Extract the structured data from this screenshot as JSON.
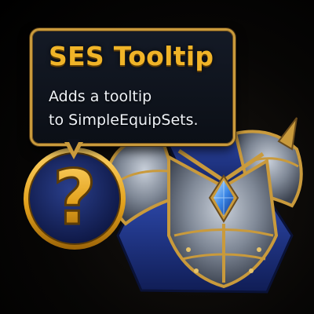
{
  "tooltip": {
    "title": "SES Tooltip",
    "line1": "Adds a tooltip",
    "line2": "to SimpleEquipSets."
  },
  "icons": {
    "question_badge": "question-mark-icon",
    "armor": "chest-armor-icon",
    "gem": "blue-gem-icon"
  },
  "colors": {
    "gold": "#f0b428",
    "gold_frame": "#c99a3c",
    "navy": "#1d2f6e",
    "steel": "#8d96a3",
    "gem_blue": "#3a86e6"
  }
}
